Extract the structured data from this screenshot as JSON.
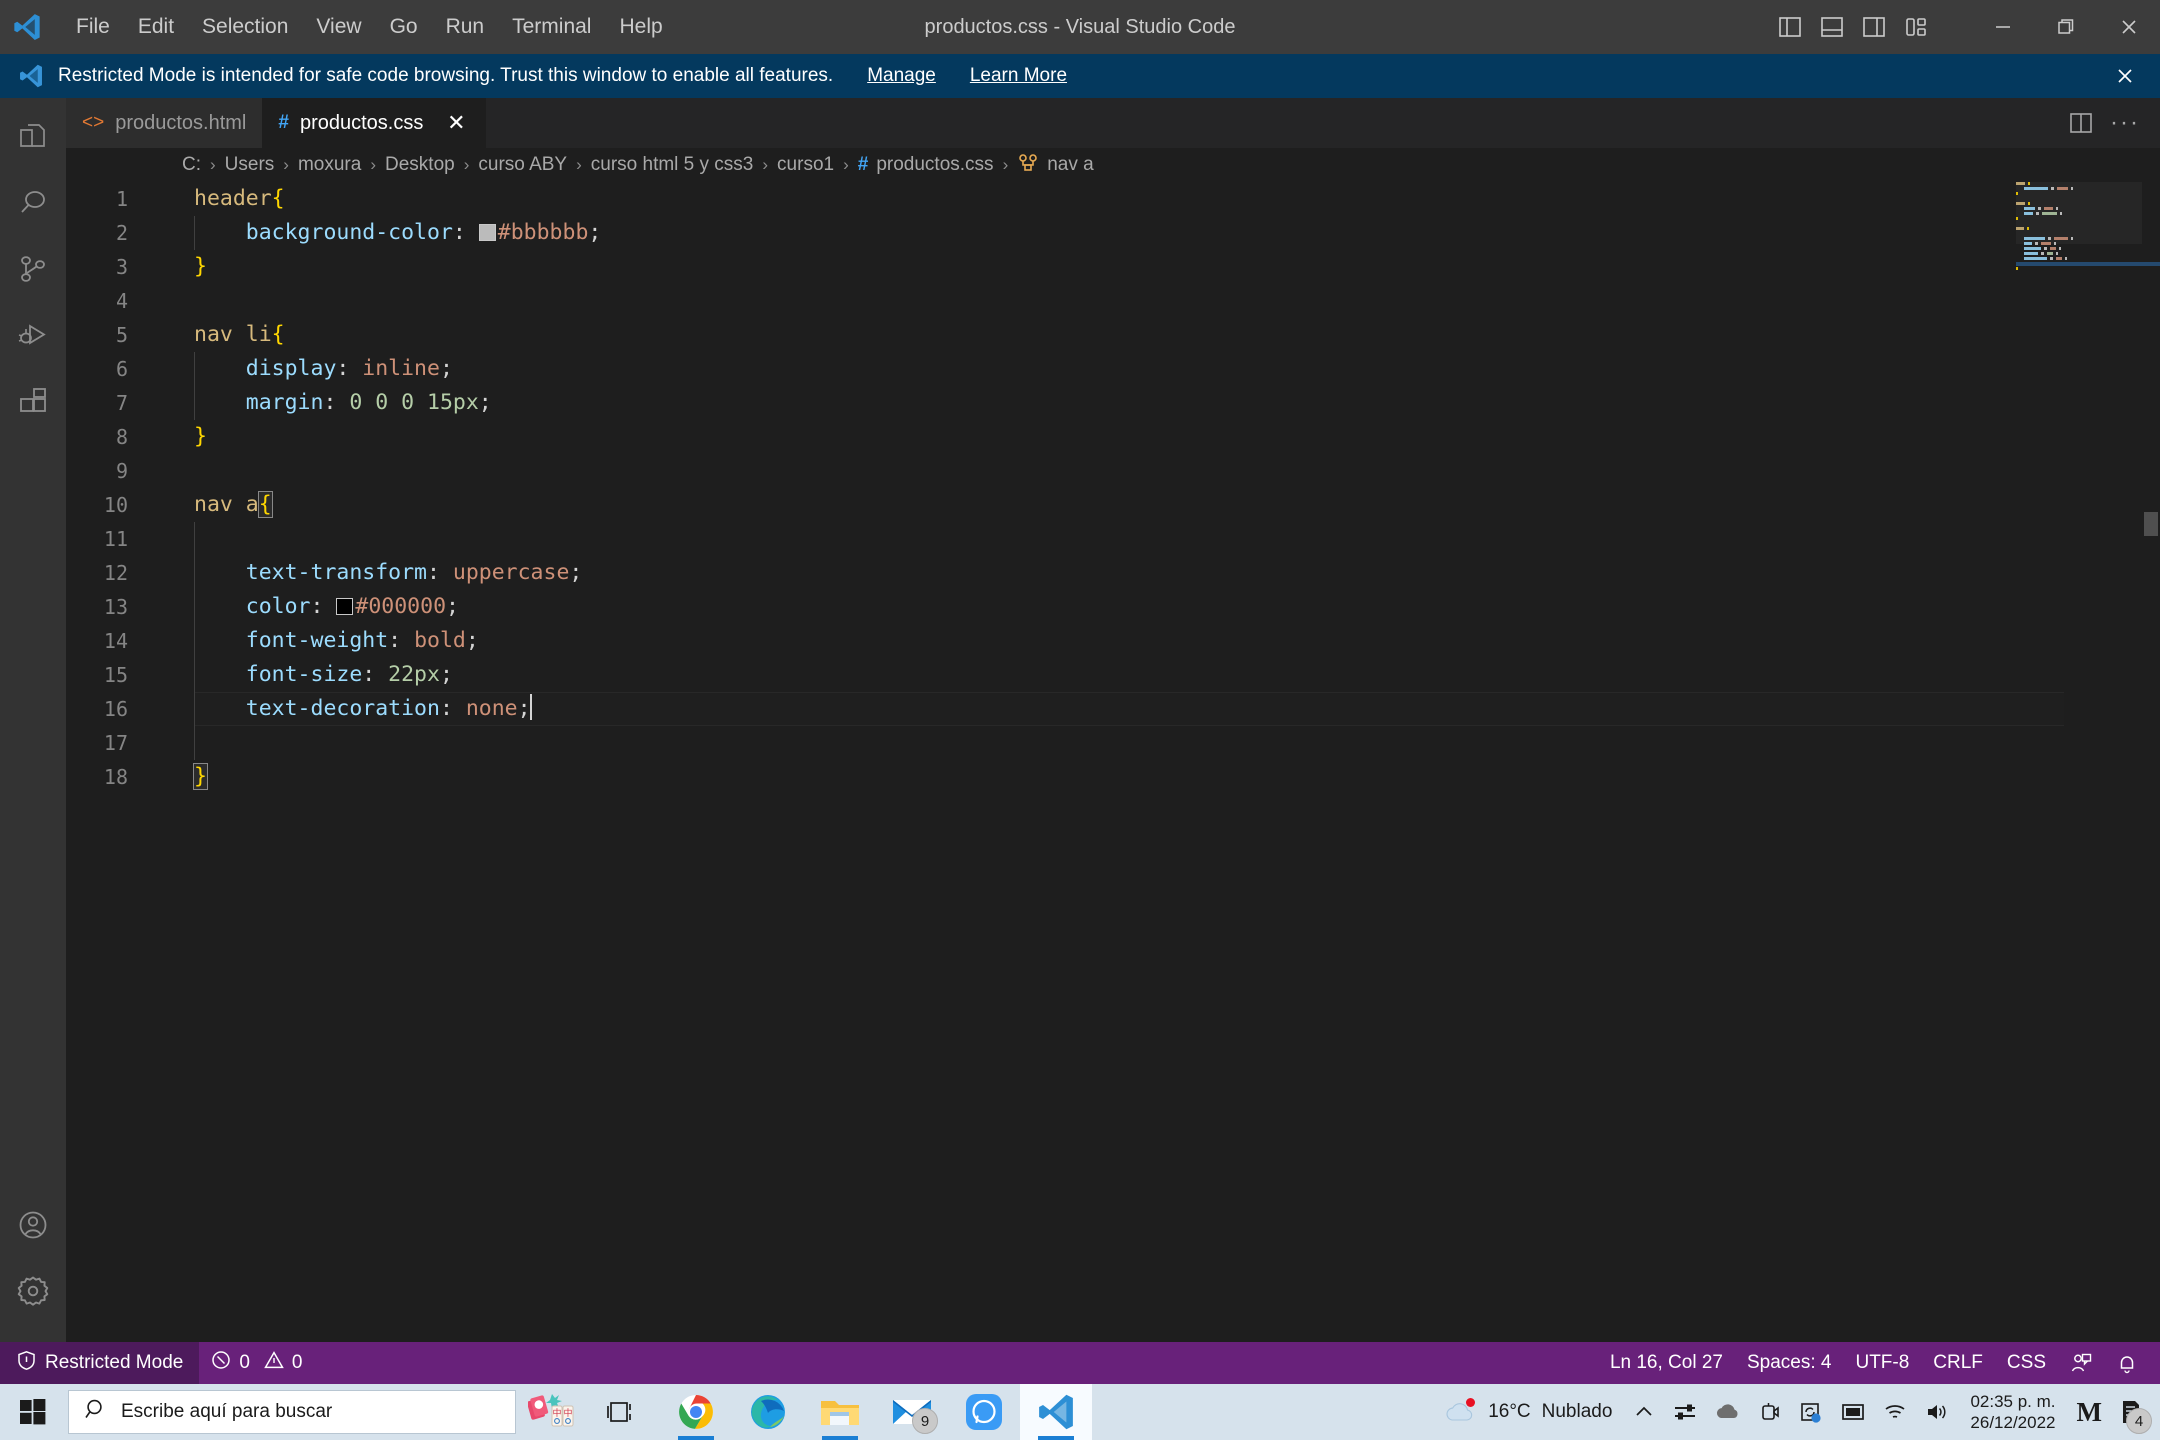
{
  "titlebar": {
    "window_title": "productos.css - Visual Studio Code",
    "logo_name": "vscode-logo",
    "menus": [
      "File",
      "Edit",
      "Selection",
      "View",
      "Go",
      "Run",
      "Terminal",
      "Help"
    ],
    "layout_buttons": [
      {
        "name": "toggle-primary-sidebar-icon",
        "label": "Toggle Primary Side Bar"
      },
      {
        "name": "toggle-panel-icon",
        "label": "Toggle Panel"
      },
      {
        "name": "toggle-secondary-sidebar-icon",
        "label": "Toggle Secondary Side Bar"
      },
      {
        "name": "customize-layout-icon",
        "label": "Customize Layout"
      }
    ],
    "window_buttons": [
      {
        "name": "minimize-button",
        "glyph": "—"
      },
      {
        "name": "maximize-button",
        "glyph": "❐"
      },
      {
        "name": "close-button",
        "glyph": "✕"
      }
    ]
  },
  "banner": {
    "message": "Restricted Mode is intended for safe code browsing. Trust this window to enable all features.",
    "links": [
      "Manage",
      "Learn More"
    ],
    "close_glyph": "✕",
    "background": "#04395e"
  },
  "activitybar": {
    "items": [
      {
        "name": "sidebar-item-explorer",
        "label": "Explorer"
      },
      {
        "name": "sidebar-item-search",
        "label": "Search"
      },
      {
        "name": "sidebar-item-source-control",
        "label": "Source Control"
      },
      {
        "name": "sidebar-item-run-debug",
        "label": "Run and Debug"
      },
      {
        "name": "sidebar-item-extensions",
        "label": "Extensions"
      }
    ],
    "bottom": [
      {
        "name": "accounts-icon",
        "label": "Accounts"
      },
      {
        "name": "settings-gear-icon",
        "label": "Manage"
      }
    ]
  },
  "tabs": [
    {
      "label": "productos.html",
      "icon": "html-file-icon",
      "icon_glyph": "<>",
      "icon_color": "#e37933",
      "active": false,
      "closable": false
    },
    {
      "label": "productos.css",
      "icon": "css-file-icon",
      "icon_glyph": "#",
      "icon_color": "#42a5f5",
      "active": true,
      "closable": true,
      "close_glyph": "✕"
    }
  ],
  "tab_actions": [
    {
      "name": "split-editor-right-icon",
      "label": "Split Editor Right"
    },
    {
      "name": "more-actions-icon",
      "label": "More Actions...",
      "glyph": "···"
    }
  ],
  "breadcrumbs": {
    "separator": "›",
    "items": [
      {
        "label": "C:",
        "icon": null
      },
      {
        "label": "Users",
        "icon": null
      },
      {
        "label": "moxura",
        "icon": null
      },
      {
        "label": "Desktop",
        "icon": null
      },
      {
        "label": "curso ABY",
        "icon": null
      },
      {
        "label": "curso html 5 y css3",
        "icon": null
      },
      {
        "label": "curso1",
        "icon": null
      },
      {
        "label": "productos.css",
        "icon": "css-file-icon",
        "icon_glyph": "#",
        "icon_color": "#42a5f5"
      },
      {
        "label": "nav a",
        "icon": "css-symbol-icon",
        "icon_color": "#e8ab53"
      }
    ]
  },
  "editor": {
    "language": "css",
    "file": "productos.css",
    "active_line": 16,
    "cursor": {
      "line": 16,
      "col": 27
    },
    "lines": [
      {
        "n": 1,
        "indent": 0,
        "tokens": [
          {
            "t": "header",
            "c": "sel"
          },
          {
            "t": "{",
            "c": "brace"
          }
        ]
      },
      {
        "n": 2,
        "indent": 1,
        "tokens": [
          {
            "t": "background-color",
            "c": "prop"
          },
          {
            "t": ": ",
            "c": "punc"
          },
          {
            "t": "#bbbbbb",
            "c": "val",
            "swatch": "#bbbbbb"
          },
          {
            "t": ";",
            "c": "punc"
          }
        ]
      },
      {
        "n": 3,
        "indent": 0,
        "tokens": [
          {
            "t": "}",
            "c": "brace"
          }
        ]
      },
      {
        "n": 4,
        "indent": 0,
        "tokens": []
      },
      {
        "n": 5,
        "indent": 0,
        "tokens": [
          {
            "t": "nav li",
            "c": "sel"
          },
          {
            "t": "{",
            "c": "brace"
          }
        ]
      },
      {
        "n": 6,
        "indent": 1,
        "tokens": [
          {
            "t": "display",
            "c": "prop"
          },
          {
            "t": ": ",
            "c": "punc"
          },
          {
            "t": "inline",
            "c": "val"
          },
          {
            "t": ";",
            "c": "punc"
          }
        ]
      },
      {
        "n": 7,
        "indent": 1,
        "tokens": [
          {
            "t": "margin",
            "c": "prop"
          },
          {
            "t": ": ",
            "c": "punc"
          },
          {
            "t": "0 0 0 15px",
            "c": "num"
          },
          {
            "t": ";",
            "c": "punc"
          }
        ]
      },
      {
        "n": 8,
        "indent": 0,
        "tokens": [
          {
            "t": "}",
            "c": "brace"
          }
        ]
      },
      {
        "n": 9,
        "indent": 0,
        "tokens": []
      },
      {
        "n": 10,
        "indent": 0,
        "tokens": [
          {
            "t": "nav a",
            "c": "sel"
          },
          {
            "t": "{",
            "c": "brace",
            "match": true
          }
        ]
      },
      {
        "n": 11,
        "indent": 1,
        "tokens": []
      },
      {
        "n": 12,
        "indent": 1,
        "tokens": [
          {
            "t": "text-transform",
            "c": "prop"
          },
          {
            "t": ": ",
            "c": "punc"
          },
          {
            "t": "uppercase",
            "c": "val"
          },
          {
            "t": ";",
            "c": "punc"
          }
        ]
      },
      {
        "n": 13,
        "indent": 1,
        "tokens": [
          {
            "t": "color",
            "c": "prop"
          },
          {
            "t": ": ",
            "c": "punc"
          },
          {
            "t": "#000000",
            "c": "val",
            "swatch": "#000000"
          },
          {
            "t": ";",
            "c": "punc"
          }
        ]
      },
      {
        "n": 14,
        "indent": 1,
        "tokens": [
          {
            "t": "font-weight",
            "c": "prop"
          },
          {
            "t": ": ",
            "c": "punc"
          },
          {
            "t": "bold",
            "c": "val"
          },
          {
            "t": ";",
            "c": "punc"
          }
        ]
      },
      {
        "n": 15,
        "indent": 1,
        "tokens": [
          {
            "t": "font-size",
            "c": "prop"
          },
          {
            "t": ": ",
            "c": "punc"
          },
          {
            "t": "22px",
            "c": "num"
          },
          {
            "t": ";",
            "c": "punc"
          }
        ]
      },
      {
        "n": 16,
        "indent": 1,
        "active": true,
        "cursor": true,
        "tokens": [
          {
            "t": "text-decoration",
            "c": "prop"
          },
          {
            "t": ": ",
            "c": "punc"
          },
          {
            "t": "none",
            "c": "val"
          },
          {
            "t": ";",
            "c": "punc"
          }
        ]
      },
      {
        "n": 17,
        "indent": 1,
        "tokens": []
      },
      {
        "n": 18,
        "indent": 0,
        "tokens": [
          {
            "t": "}",
            "c": "brace",
            "match": true
          }
        ]
      }
    ]
  },
  "statusbar": {
    "background": "#68217a",
    "restricted_mode": {
      "label": "Restricted Mode",
      "icon": "shield-icon",
      "background": "#4d1a5c"
    },
    "problems": {
      "errors": "0",
      "warnings": "0",
      "error_icon": "error-circle-icon",
      "warning_icon": "warning-triangle-icon"
    },
    "right": [
      {
        "name": "editor-position",
        "label": "Ln 16, Col 27"
      },
      {
        "name": "editor-indentation",
        "label": "Spaces: 4"
      },
      {
        "name": "editor-encoding",
        "label": "UTF-8"
      },
      {
        "name": "editor-eol",
        "label": "CRLF"
      },
      {
        "name": "editor-language",
        "label": "CSS"
      },
      {
        "name": "feedback-icon",
        "label": "Tweet Feedback"
      },
      {
        "name": "notifications-bell-icon",
        "label": "No Notifications"
      }
    ]
  },
  "taskbar": {
    "background": "#d6e2ec",
    "start_button": "start-button",
    "search": {
      "placeholder": "Escribe aquí para buscar",
      "icon": "search-icon"
    },
    "pinned": [
      {
        "name": "mahjong-icon",
        "label": "Mahjong"
      },
      {
        "name": "task-view-icon",
        "label": "Task View"
      },
      {
        "name": "chrome-icon",
        "label": "Google Chrome",
        "running": true
      },
      {
        "name": "edge-icon",
        "label": "Microsoft Edge",
        "running": false
      },
      {
        "name": "file-explorer-icon",
        "label": "Explorador de archivos",
        "running": true
      },
      {
        "name": "mail-icon",
        "label": "Correo",
        "badge": "9"
      },
      {
        "name": "messenger-icon",
        "label": "Messenger"
      },
      {
        "name": "vscode-taskbar-icon",
        "label": "Visual Studio Code",
        "running": true,
        "active": true
      }
    ],
    "tray": {
      "weather": {
        "icon": "weather-cloud-icon",
        "temperature": "16°C",
        "condition": "Nublado",
        "alert_dot": "#e81123"
      },
      "items": [
        {
          "name": "show-hidden-icons-chevron",
          "glyph": "∧"
        },
        {
          "name": "network-settings-icon"
        },
        {
          "name": "onedrive-cloud-icon"
        },
        {
          "name": "camera-icon"
        },
        {
          "name": "sync-update-icon"
        },
        {
          "name": "display-icon"
        },
        {
          "name": "wifi-icon"
        },
        {
          "name": "volume-icon"
        }
      ],
      "clock": {
        "time": "02:35 p. m.",
        "date": "26/12/2022"
      },
      "right_icons": [
        {
          "name": "meet-logo-icon",
          "label": "M"
        },
        {
          "name": "notifications-icon",
          "badge": "4"
        }
      ]
    }
  }
}
